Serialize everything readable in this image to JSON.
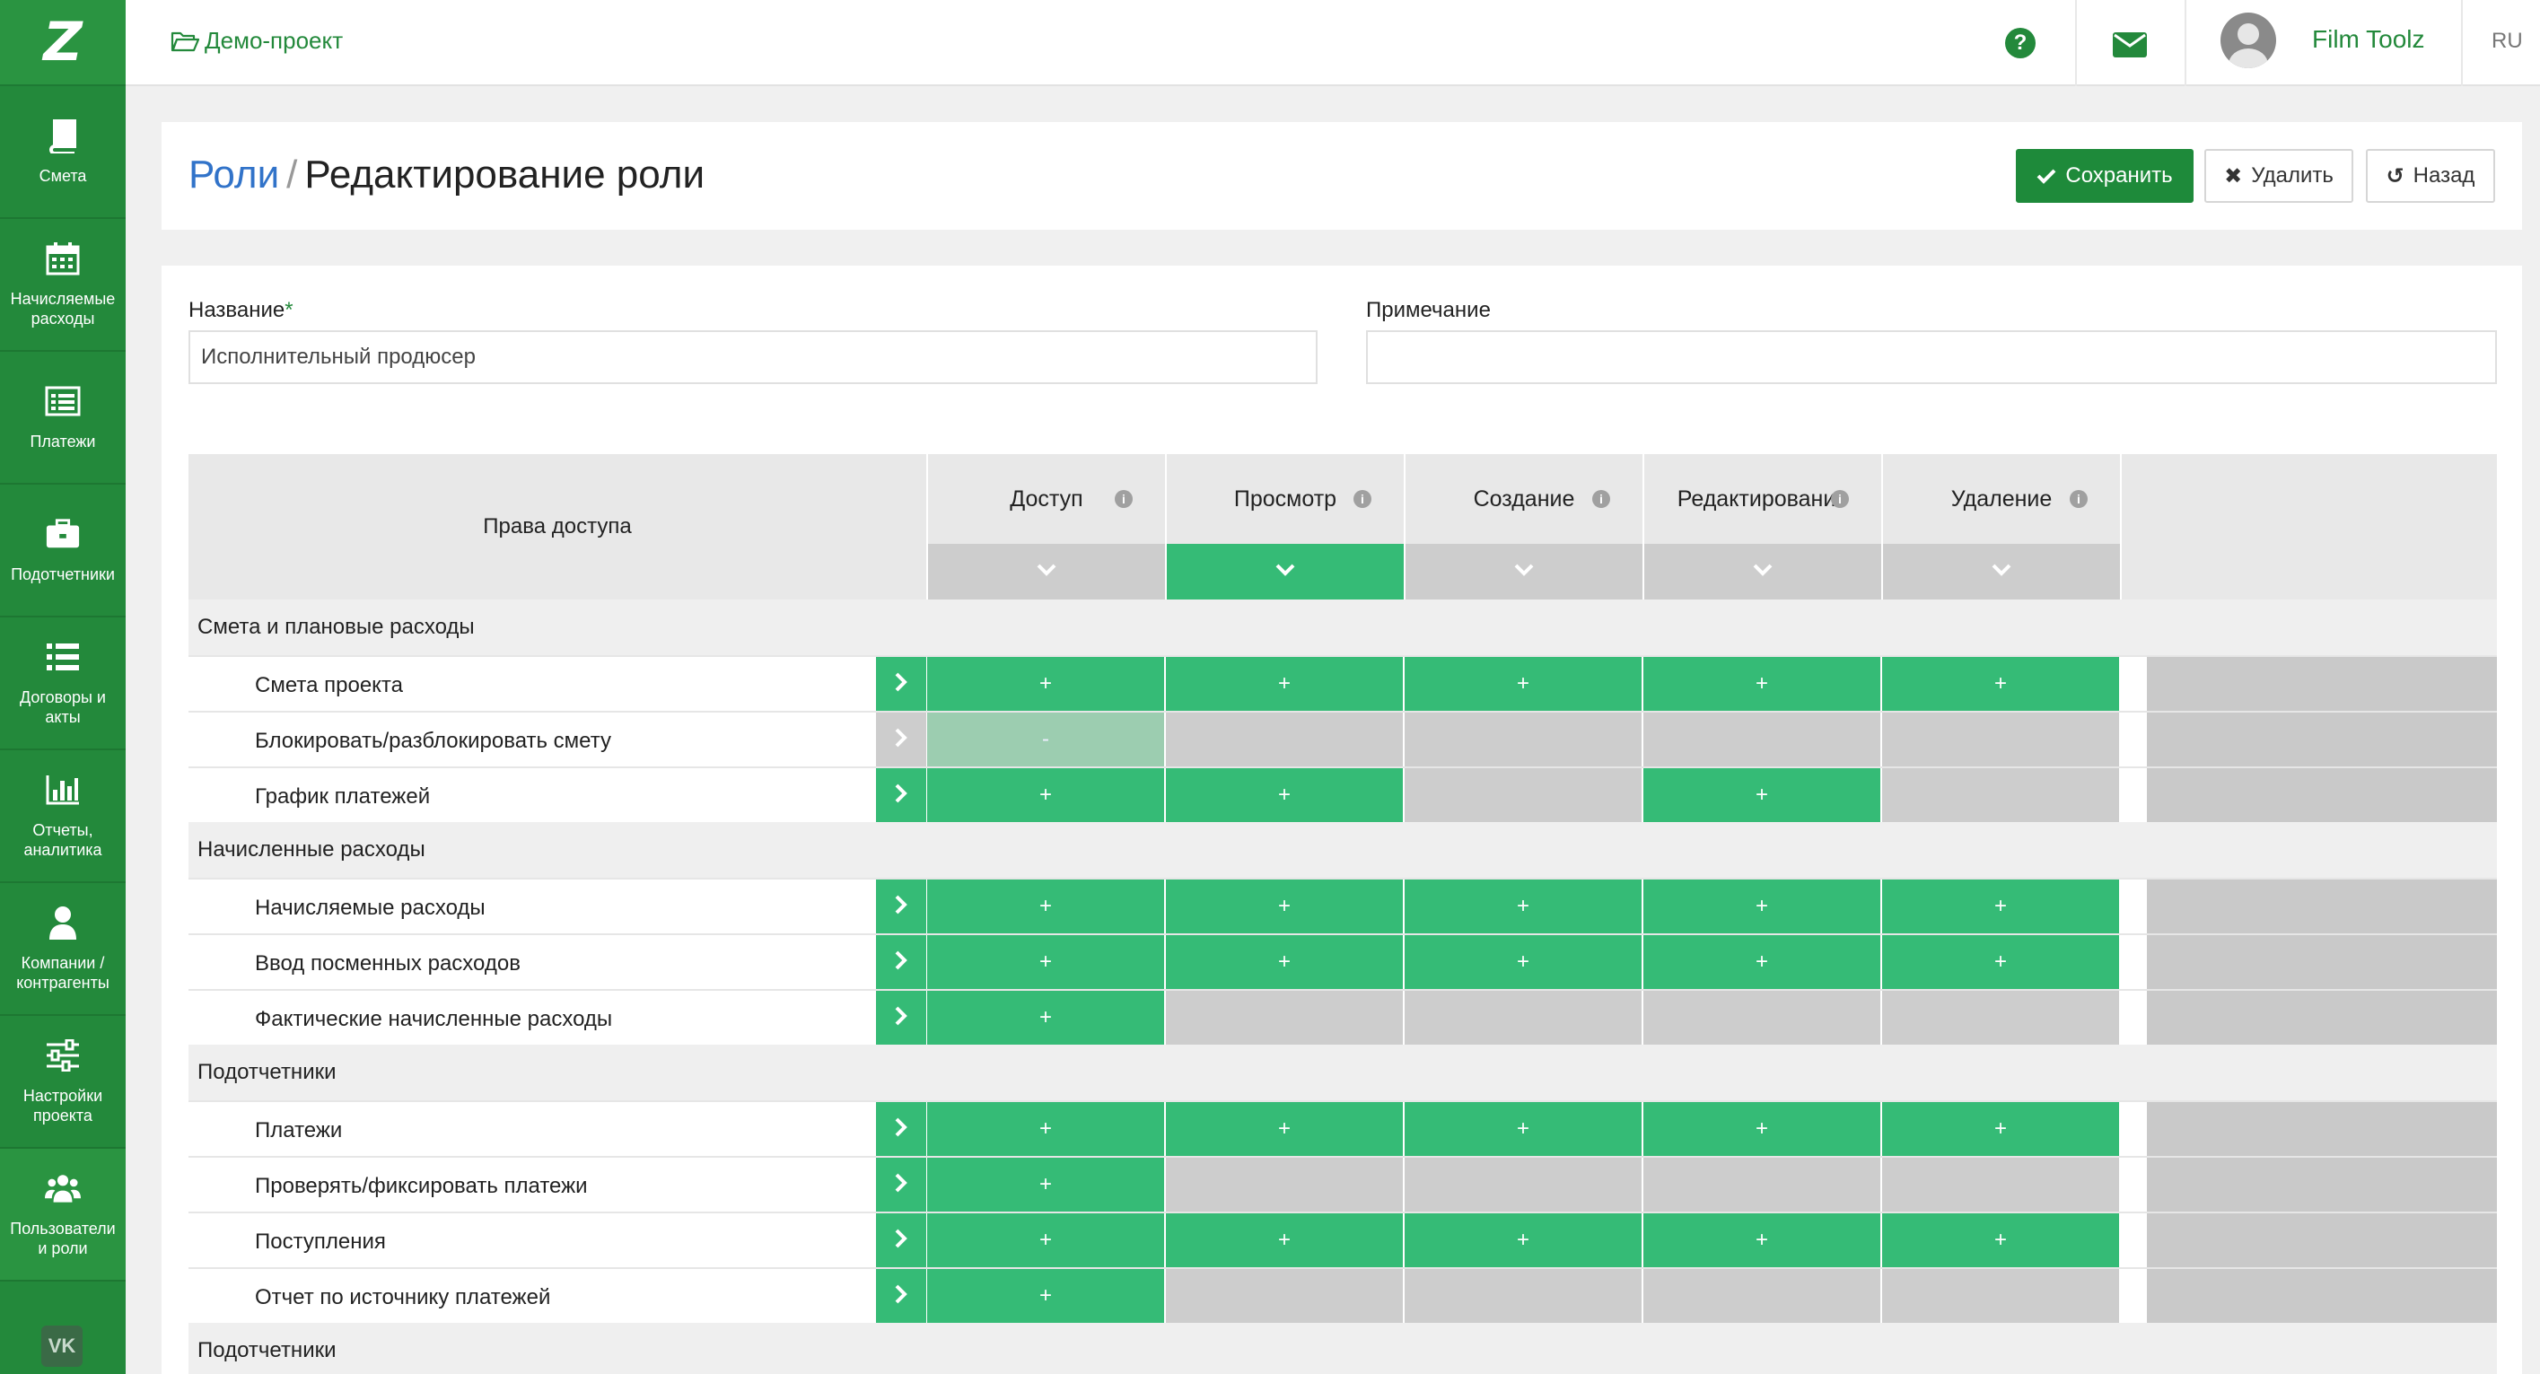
{
  "sidebar": {
    "logo": "Z",
    "items": [
      {
        "label": "Смета",
        "icon": "book-icon"
      },
      {
        "label": "Начисляемые расходы",
        "icon": "calendar-icon"
      },
      {
        "label": "Платежи",
        "icon": "list-alt-icon"
      },
      {
        "label": "Подотчетники",
        "icon": "briefcase-icon"
      },
      {
        "label": "Договоры и акты",
        "icon": "list-icon"
      },
      {
        "label": "Отчеты, аналитика",
        "icon": "bar-chart-icon"
      },
      {
        "label": "Компании / контрагенты",
        "icon": "user-icon"
      },
      {
        "label": "Настройки проекта",
        "icon": "sliders-icon"
      },
      {
        "label": "Пользователи и роли",
        "icon": "users-icon"
      }
    ],
    "vk": "VK"
  },
  "topbar": {
    "project": "Демо-проект",
    "user_name": "Film Toolz",
    "lang": "RU"
  },
  "header": {
    "breadcrumb_link": "Роли",
    "breadcrumb_sep": "/",
    "title": "Редактирование роли",
    "save_label": "Сохранить",
    "delete_label": "Удалить",
    "back_label": "Назад"
  },
  "form": {
    "name_label": "Название",
    "name_required": "*",
    "name_value": "Исполнительный продюсер",
    "note_label": "Примечание",
    "note_value": ""
  },
  "permissions": {
    "title": "Права доступа",
    "columns": [
      "Доступ",
      "Просмотр",
      "Создание",
      "Редактирование",
      "Удаление"
    ],
    "column_active": [
      false,
      true,
      false,
      false,
      false
    ],
    "groups": [
      {
        "name": "Смета и плановые расходы",
        "rows": [
          {
            "name": "Смета проекта",
            "enabled": true,
            "cells": [
              "+",
              "+",
              "+",
              "+",
              "+"
            ]
          },
          {
            "name": "Блокировать/разблокировать смету",
            "enabled": false,
            "cells": [
              "-",
              "",
              "",
              "",
              ""
            ]
          },
          {
            "name": "График платежей",
            "enabled": true,
            "cells": [
              "+",
              "+",
              "",
              "+",
              ""
            ]
          }
        ]
      },
      {
        "name": "Начисленные расходы",
        "rows": [
          {
            "name": "Начисляемые расходы",
            "enabled": true,
            "cells": [
              "+",
              "+",
              "+",
              "+",
              "+"
            ]
          },
          {
            "name": "Ввод посменных расходов",
            "enabled": true,
            "cells": [
              "+",
              "+",
              "+",
              "+",
              "+"
            ]
          },
          {
            "name": "Фактические начисленные расходы",
            "enabled": true,
            "cells": [
              "+",
              "",
              "",
              "",
              ""
            ]
          }
        ]
      },
      {
        "name": "Подотчетники",
        "rows": [
          {
            "name": "Платежи",
            "enabled": true,
            "cells": [
              "+",
              "+",
              "+",
              "+",
              "+"
            ]
          },
          {
            "name": "Проверять/фиксировать платежи",
            "enabled": true,
            "cells": [
              "+",
              "",
              "",
              "",
              ""
            ]
          },
          {
            "name": "Поступления",
            "enabled": true,
            "cells": [
              "+",
              "+",
              "+",
              "+",
              "+"
            ]
          },
          {
            "name": "Отчет по источнику платежей",
            "enabled": true,
            "cells": [
              "+",
              "",
              "",
              "",
              ""
            ]
          }
        ]
      },
      {
        "name": "Подотчетники",
        "rows": []
      }
    ]
  },
  "colors": {
    "brand": "#23893b",
    "cell_on": "#35bb76",
    "cell_off": "#cdcdcd",
    "link": "#3173c9"
  }
}
